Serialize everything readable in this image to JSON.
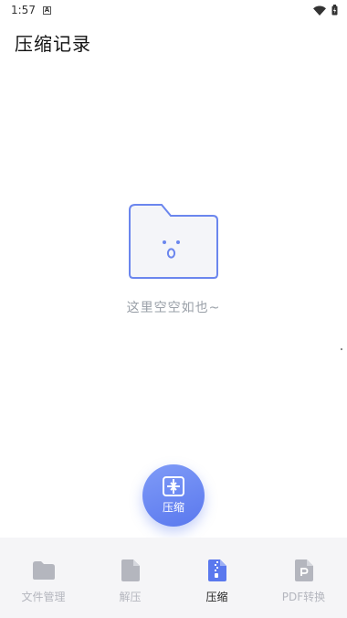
{
  "status_bar": {
    "time": "1:57",
    "notification_badge": "A",
    "icons": [
      "wifi-icon",
      "battery-icon"
    ]
  },
  "header": {
    "title": "压缩记录"
  },
  "empty_state": {
    "icon": "empty-folder-icon",
    "message": "这里空空如也~"
  },
  "fab": {
    "icon": "compress-icon",
    "label": "压缩"
  },
  "bottom_nav": {
    "items": [
      {
        "label": "文件管理",
        "icon": "folder-icon",
        "active": false
      },
      {
        "label": "解压",
        "icon": "file-icon",
        "active": false
      },
      {
        "label": "压缩",
        "icon": "zip-file-icon",
        "active": true
      },
      {
        "label": "PDF转换",
        "icon": "pdf-file-icon",
        "active": false
      }
    ]
  },
  "colors": {
    "accent": "#5a78ee",
    "inactive": "#b4b6be",
    "nav_background": "#f5f5f7"
  }
}
